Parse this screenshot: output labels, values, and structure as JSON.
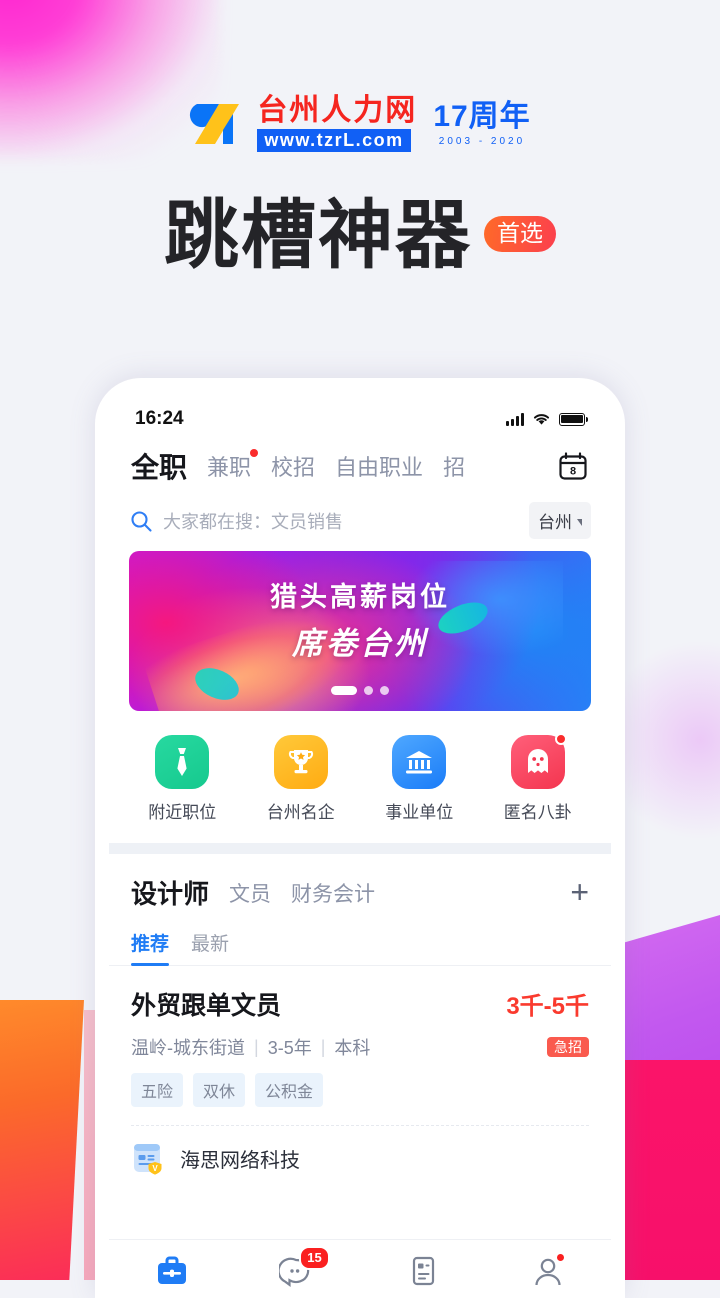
{
  "promo": {
    "logo_cn": "台州人力网",
    "logo_url": "www.tzrL.com",
    "anniversary_main": "17周年",
    "anniversary_years": "2003 - 2020",
    "headline": "跳槽神器",
    "badge": "首选",
    "brand_red": "#f5251f",
    "brand_blue": "#1160f5",
    "badge_gradient_from": "#ff6a28",
    "badge_gradient_to": "#fb3f4e"
  },
  "phone": {
    "status": {
      "time": "16:24",
      "signal_icon": "cellular-signal-icon",
      "wifi_icon": "wifi-icon",
      "battery_icon": "battery-icon"
    },
    "tabs": [
      {
        "label": "全职",
        "active": true,
        "dot": false
      },
      {
        "label": "兼职",
        "active": false,
        "dot": true
      },
      {
        "label": "校招",
        "active": false,
        "dot": false
      },
      {
        "label": "自由职业",
        "active": false,
        "dot": false
      },
      {
        "label": "招",
        "active": false,
        "dot": false
      }
    ],
    "calendar_icon_day": "8",
    "search": {
      "icon": "search-icon",
      "placeholder": "大家都在搜：文员销售",
      "city": "台州"
    },
    "banner": {
      "line1": "猎头高薪岗位",
      "line2": "席卷台州",
      "dots": 3,
      "active_dot": 1
    },
    "quick_entries": [
      {
        "label": "附近职位",
        "icon": "necktie-icon",
        "color": "#16c98e",
        "badge": false
      },
      {
        "label": "台州名企",
        "icon": "trophy-icon",
        "color": "#ffab12",
        "badge": false
      },
      {
        "label": "事业单位",
        "icon": "bank-icon",
        "color": "#1a7cf8",
        "badge": false
      },
      {
        "label": "匿名八卦",
        "icon": "ghost-icon",
        "color": "#f4354f",
        "badge": true
      }
    ],
    "categories": [
      {
        "label": "设计师",
        "active": true
      },
      {
        "label": "文员",
        "active": false
      },
      {
        "label": "财务会计",
        "active": false
      }
    ],
    "add_category_label": "+",
    "subtabs": [
      {
        "label": "推荐",
        "active": true
      },
      {
        "label": "最新",
        "active": false
      }
    ],
    "job": {
      "title": "外贸跟单文员",
      "salary": "3千-5千",
      "location": "温岭-城东街道",
      "experience": "3-5年",
      "education": "本科",
      "urgent_badge": "急招",
      "tags": [
        "五险",
        "双休",
        "公积金"
      ],
      "company": "海思网络科技",
      "company_icon": "company-verified-icon",
      "accent_red": "#fa3a2e",
      "accent_blue": "#1f7cf5"
    },
    "bottom_nav": [
      {
        "name": "jobs",
        "icon": "briefcase-icon",
        "active": true,
        "badge": null,
        "dot": false
      },
      {
        "name": "messages",
        "icon": "chat-bubble-icon",
        "active": false,
        "badge": "15",
        "dot": false
      },
      {
        "name": "resume",
        "icon": "resume-icon",
        "active": false,
        "badge": null,
        "dot": false
      },
      {
        "name": "profile",
        "icon": "person-icon",
        "active": false,
        "badge": null,
        "dot": true
      }
    ]
  }
}
